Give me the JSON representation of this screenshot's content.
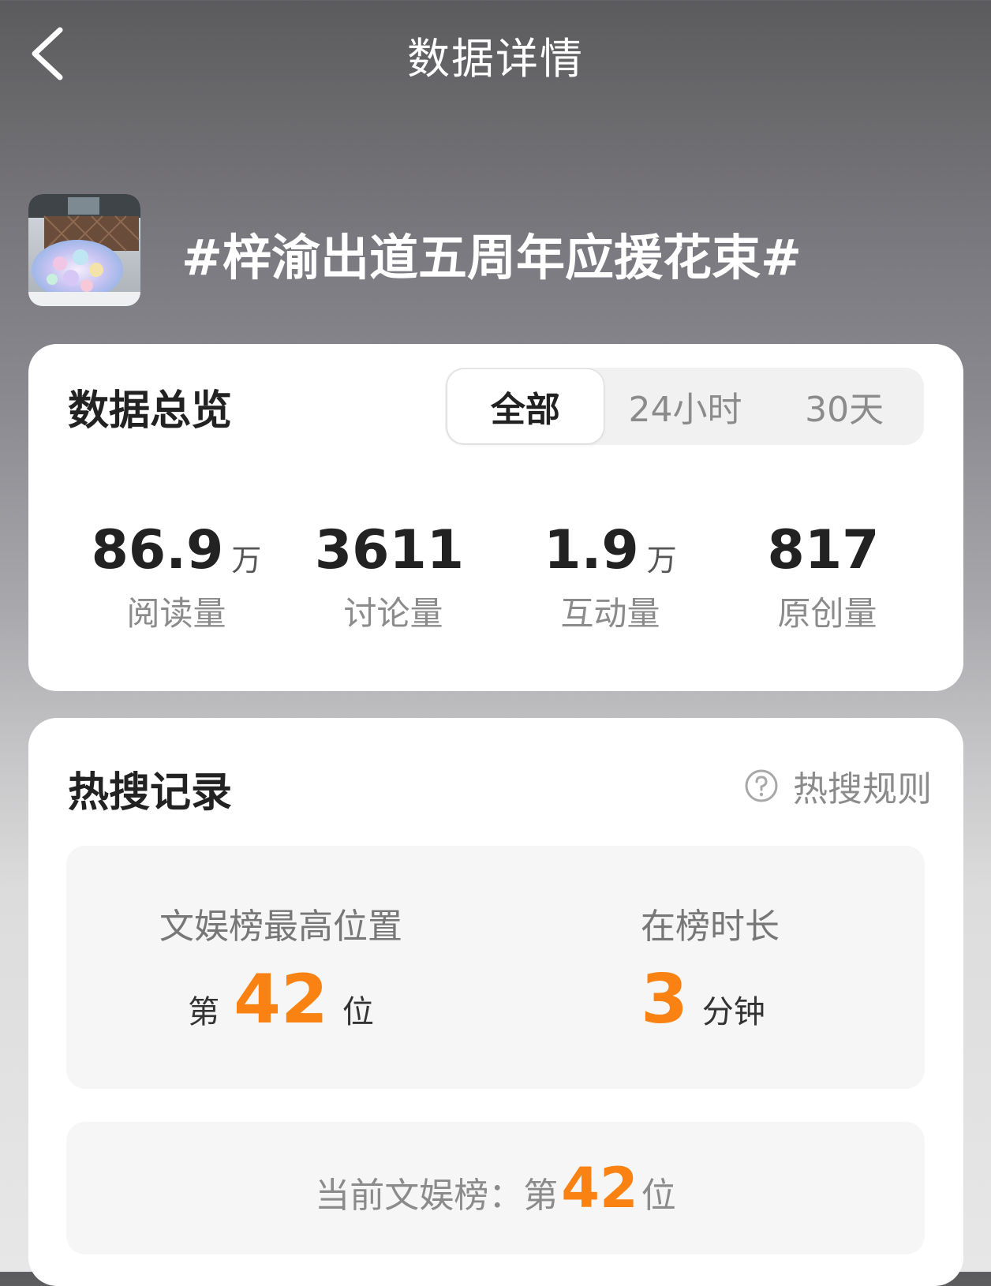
{
  "header": {
    "title": "数据详情"
  },
  "topic": {
    "title": "#梓渝出道五周年应援花束#"
  },
  "overview": {
    "title": "数据总览",
    "tabs": [
      {
        "label": "全部",
        "active": true
      },
      {
        "label": "24小时",
        "active": false
      },
      {
        "label": "30天",
        "active": false
      }
    ],
    "stats": [
      {
        "value": "86.9",
        "unit": "万",
        "label": "阅读量"
      },
      {
        "value": "3611",
        "unit": "",
        "label": "讨论量"
      },
      {
        "value": "1.9",
        "unit": "万",
        "label": "互动量"
      },
      {
        "value": "817",
        "unit": "",
        "label": "原创量"
      }
    ]
  },
  "hot_search": {
    "title": "热搜记录",
    "rules_label": "热搜规则",
    "highest": {
      "title": "文娱榜最高位置",
      "prefix": "第",
      "value": "42",
      "suffix": "位"
    },
    "duration": {
      "title": "在榜时长",
      "value": "3",
      "suffix": "分钟"
    },
    "current": {
      "label": "当前文娱榜：",
      "prefix": "第",
      "value": "42",
      "suffix": "位"
    }
  },
  "colors": {
    "accent": "#f98212",
    "text_primary": "#222222",
    "text_secondary": "#8b8b8b"
  },
  "icons": {
    "back": "chevron-left-icon",
    "help": "question-circle-icon"
  }
}
